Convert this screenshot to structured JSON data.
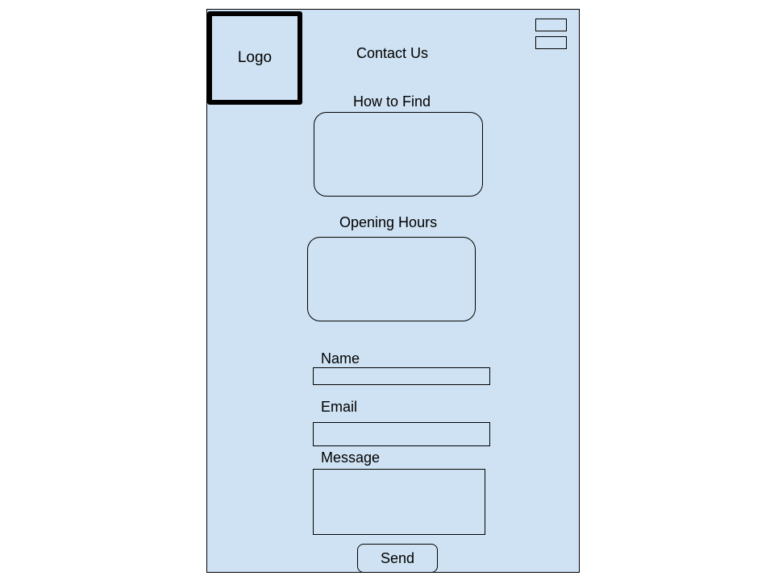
{
  "header": {
    "logo_label": "Logo",
    "title": "Contact Us"
  },
  "sections": {
    "how_to_find": "How to Find",
    "opening_hours": "Opening Hours"
  },
  "form": {
    "name_label": "Name",
    "email_label": "Email",
    "message_label": "Message",
    "send_label": "Send"
  },
  "colors": {
    "background": "#cfe2f3",
    "stroke": "#000000"
  }
}
